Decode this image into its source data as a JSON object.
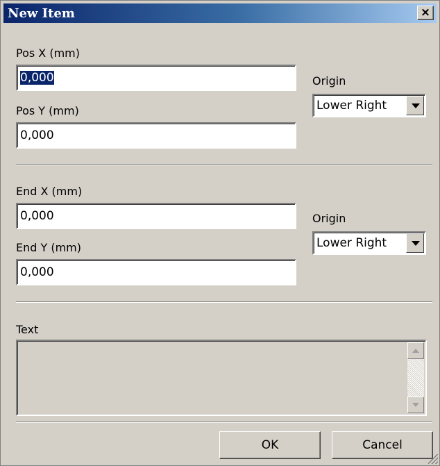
{
  "window": {
    "title": "New Item",
    "close_label": "×"
  },
  "start": {
    "pos_x_label": "Pos X (mm)",
    "pos_x_value": "0,000",
    "pos_y_label": "Pos Y (mm)",
    "pos_y_value": "0,000",
    "origin_label": "Origin",
    "origin_value": "Lower Right"
  },
  "end": {
    "end_x_label": "End X (mm)",
    "end_x_value": "0,000",
    "end_y_label": "End Y (mm)",
    "end_y_value": "0,000",
    "origin_label": "Origin",
    "origin_value": "Lower Right"
  },
  "text": {
    "label": "Text",
    "value": ""
  },
  "buttons": {
    "ok": "OK",
    "cancel": "Cancel"
  },
  "colors": {
    "title_gradient_start": "#0a246a",
    "title_gradient_end": "#a6caf0",
    "face": "#d4d0c8",
    "selection": "#0a246a"
  }
}
